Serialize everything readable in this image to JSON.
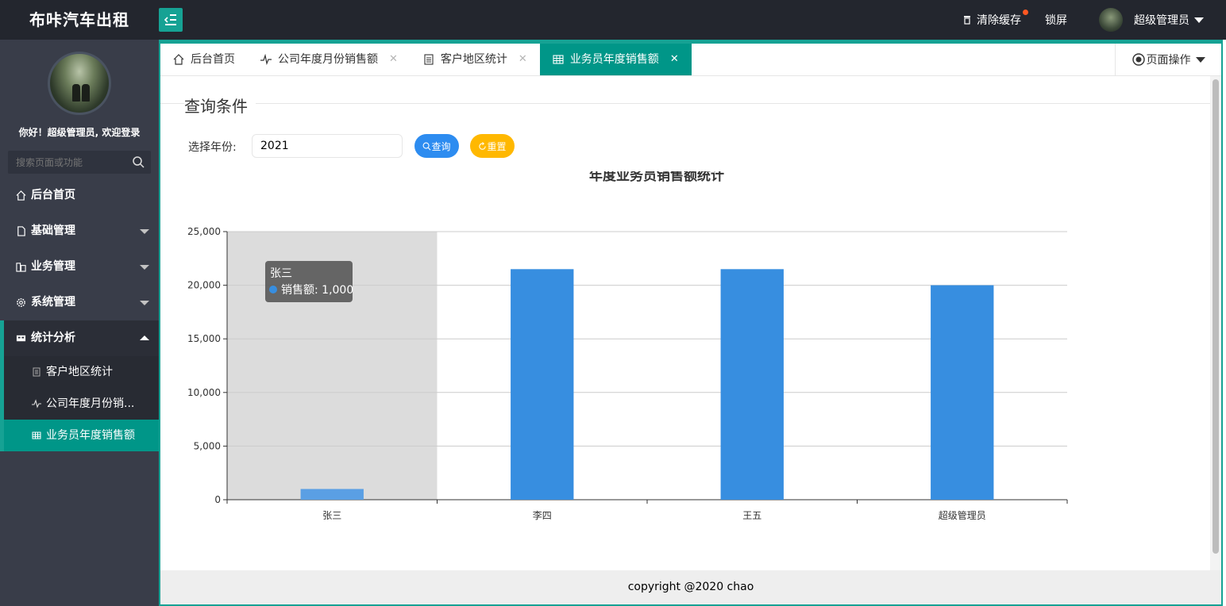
{
  "header": {
    "app_title": "布咔汽车出租",
    "clear_cache": "清除缓存",
    "lock_screen": "锁屏",
    "user_name": "超级管理员"
  },
  "sidebar": {
    "welcome": "你好！超级管理员, 欢迎登录",
    "search_placeholder": "搜索页面或功能",
    "items": [
      {
        "label": "后台首页",
        "icon": "home-icon"
      },
      {
        "label": "基础管理",
        "icon": "file-icon"
      },
      {
        "label": "业务管理",
        "icon": "building-icon"
      },
      {
        "label": "系统管理",
        "icon": "gear-icon"
      },
      {
        "label": "统计分析",
        "icon": "chart-icon"
      }
    ],
    "sub_items": [
      {
        "label": "客户地区统计",
        "icon": "report-icon"
      },
      {
        "label": "公司年度月份销...",
        "icon": "pulse-icon"
      },
      {
        "label": "业务员年度销售额",
        "icon": "table-icon"
      }
    ]
  },
  "tabs": [
    {
      "label": "后台首页",
      "icon": "home-icon"
    },
    {
      "label": "公司年度月份销售额",
      "icon": "pulse-icon"
    },
    {
      "label": "客户地区统计",
      "icon": "report-icon"
    },
    {
      "label": "业务员年度销售额",
      "icon": "table-icon"
    }
  ],
  "page_ops": "页面操作",
  "query": {
    "title": "查询条件",
    "year_label": "选择年份:",
    "year_value": "2021",
    "query_button": "查询",
    "reset_button": "重置"
  },
  "chart_data": {
    "type": "bar",
    "title": "年度业务员销售额统计",
    "categories": [
      "张三",
      "李四",
      "王五",
      "超级管理员"
    ],
    "series": [
      {
        "name": "销售额",
        "values": [
          1000,
          21500,
          21500,
          20000
        ]
      }
    ],
    "ylim": [
      0,
      25000
    ],
    "yticks": [
      "0",
      "5,000",
      "10,000",
      "15,000",
      "20,000",
      "25,000"
    ],
    "grid": true,
    "color": "#378ee0",
    "tooltip": {
      "category": "张三",
      "text": "销售额: 1,000"
    }
  },
  "footer": "copyright @2020 chao"
}
